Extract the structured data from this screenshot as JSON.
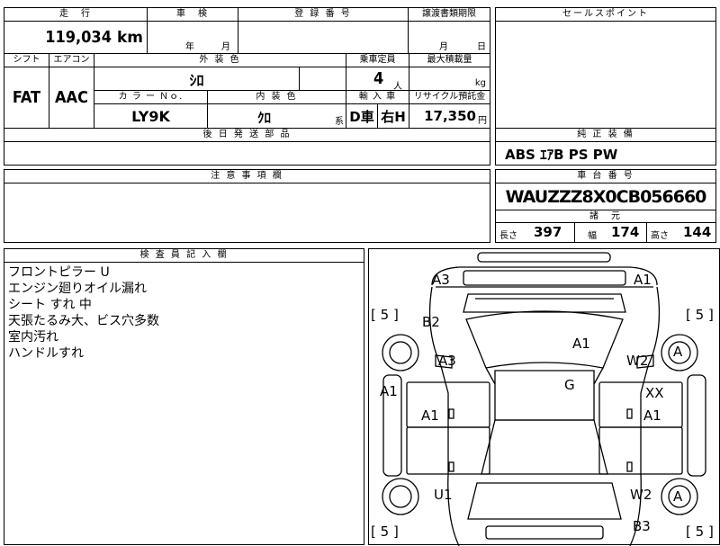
{
  "header": {
    "mileage_label": "走　行",
    "mileage_value": "119,034",
    "mileage_unit": "km",
    "inspection_label": "車　検",
    "inspection_year": "年",
    "inspection_month": "月",
    "registration_label": "登 録 番 号",
    "transfer_doc_label": "譲渡書類期限",
    "transfer_month": "月",
    "transfer_day": "日",
    "sales_point_label": "セールスポイント"
  },
  "specs": {
    "shift_label": "シフト",
    "aircon_label": "エアコン",
    "exterior_label": "外 装 色",
    "capacity_label": "乗車定員",
    "maxload_label": "最大積載量",
    "shift_value": "FAT",
    "aircon_value": "AAC",
    "exterior_value": "ｼﾛ",
    "capacity_value": "4",
    "capacity_unit": "人",
    "maxload_unit": "kg",
    "color_no_label": "カ ラ ー Ｎｏ.",
    "interior_label": "内 装 色",
    "import_label": "輸 入 車",
    "recycle_label": "リサイクル預託金",
    "color_no_value": "LY9K",
    "interior_value": "ｸﾛ",
    "interior_suffix": "系",
    "import_dealer": "D車",
    "handle_side": "右H",
    "recycle_value": "17,350",
    "recycle_unit": "円",
    "later_parts_label": "後 日 発 送 部 品"
  },
  "equipment": {
    "label": "純 正 装 備",
    "value": "ABS ｴｱB PS PW"
  },
  "caution": {
    "label": "注 意 事 項 欄"
  },
  "chassis": {
    "label": "車 台 番 号",
    "value": "WAUZZZ8X0CB056660",
    "dims_label": "諸　元",
    "length_label": "長さ",
    "length_value": "397",
    "width_label": "幅",
    "width_value": "174",
    "height_label": "高さ",
    "height_value": "144"
  },
  "inspector": {
    "label": "検 査 員 記 入 欄",
    "notes": [
      "フロントピラー U",
      "エンジン廻りオイル漏れ",
      "シート すれ 中",
      "天張たるみ大、ビス穴多数",
      "室内汚れ",
      "ハンドルすれ"
    ]
  },
  "diagram": {
    "marks": {
      "a3_top": "A3",
      "a1_top": "A1",
      "b2": "B2",
      "a3_left": "A3",
      "a1_roof": "A1",
      "w2_right": "W2",
      "g": "G",
      "a1_leftside": "A1",
      "a1_leftdoor": "A1",
      "xx": "XX",
      "a1_rightdoor": "A1",
      "u1": "U1",
      "w2_rear": "W2",
      "b3": "B3"
    },
    "tires": {
      "front_right": "A",
      "rear_right": "A"
    },
    "tread": {
      "front_left": "5",
      "front_right": "5",
      "rear_left": "5",
      "rear_right": "5"
    }
  }
}
